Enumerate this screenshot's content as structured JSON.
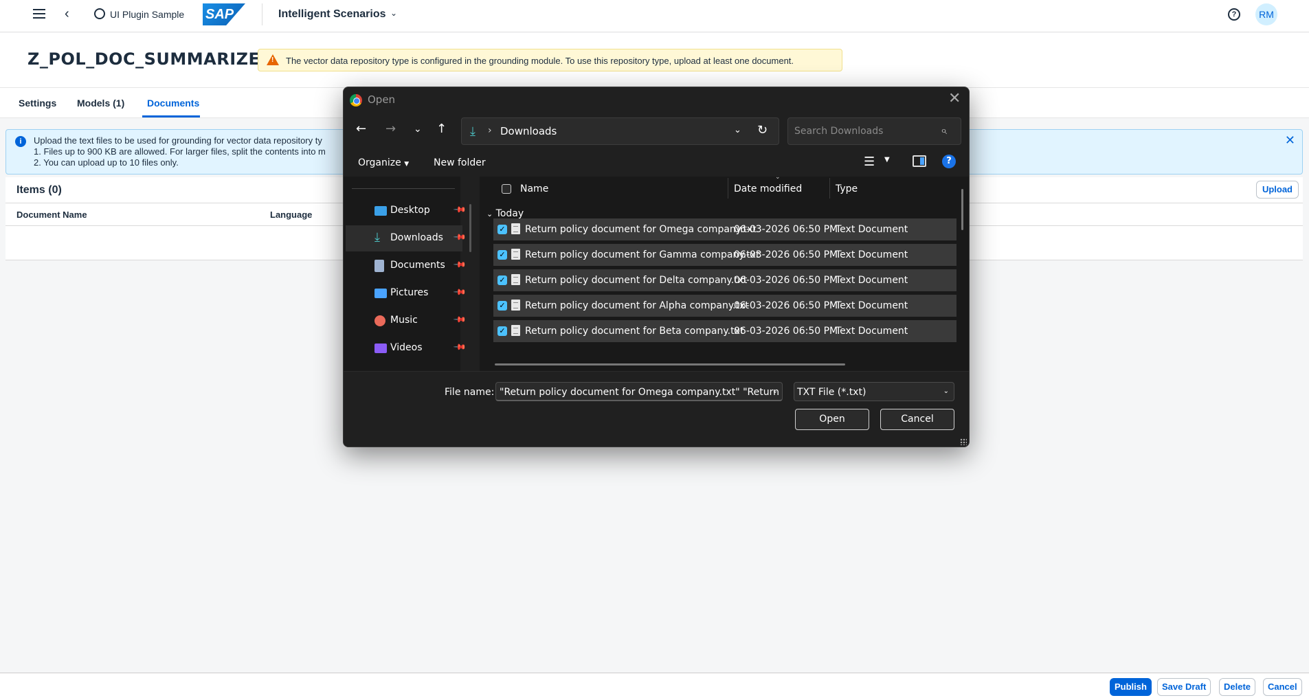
{
  "shell": {
    "app_name": "UI Plugin Sample",
    "sap_logo": "SAP",
    "scenario_menu": "Intelligent Scenarios",
    "help_icon": "?",
    "avatar_initials": "RM"
  },
  "header": {
    "title": "Z_POL_DOC_SUMMARIZE",
    "warning": "The vector data repository type is configured in the grounding module. To use this repository type, upload at least one document."
  },
  "tabs": [
    {
      "label": "Settings",
      "active": false
    },
    {
      "label": "Models (1)",
      "active": false
    },
    {
      "label": "Documents",
      "active": true
    }
  ],
  "info": {
    "line1": "Upload the text files to be used for grounding for vector data repository ty",
    "line2": "1. Files up to 900 KB are allowed. For larger files, split the contents into m",
    "line3": "2. You can upload up to 10 files only."
  },
  "items": {
    "header": "Items (0)",
    "upload_label": "Upload",
    "columns": [
      "Document Name",
      "Language"
    ]
  },
  "footer": {
    "publish": "Publish",
    "save_draft": "Save Draft",
    "delete": "Delete",
    "cancel": "Cancel"
  },
  "dialog": {
    "title": "Open",
    "address_location": "Downloads",
    "search_placeholder": "Search Downloads",
    "organize_label": "Organize",
    "new_folder_label": "New folder",
    "help_label": "?",
    "nav_items": [
      {
        "label": "Desktop",
        "icon": "desktop-icon",
        "color": "#3aa0e8"
      },
      {
        "label": "Downloads",
        "icon": "download-icon",
        "color": "#4cc2c4",
        "selected": true
      },
      {
        "label": "Documents",
        "icon": "document-icon",
        "color": "#9fb3d1"
      },
      {
        "label": "Pictures",
        "icon": "picture-icon",
        "color": "#4aa3ff"
      },
      {
        "label": "Music",
        "icon": "music-icon",
        "color": "#ea6a5a"
      },
      {
        "label": "Videos",
        "icon": "video-icon",
        "color": "#8b5cf6"
      }
    ],
    "columns": {
      "name": "Name",
      "date": "Date modified",
      "type": "Type"
    },
    "group_label": "Today",
    "files": [
      {
        "name": "Return policy document for Omega company.txt",
        "date": "06-03-2026 06:50 PM",
        "type": "Text Document",
        "checked": true
      },
      {
        "name": "Return policy document for Gamma company.txt",
        "date": "06-03-2026 06:50 PM",
        "type": "Text Document",
        "checked": true
      },
      {
        "name": "Return policy document for Delta company.txt",
        "date": "06-03-2026 06:50 PM",
        "type": "Text Document",
        "checked": true
      },
      {
        "name": "Return policy document for Alpha company.txt",
        "date": "06-03-2026 06:50 PM",
        "type": "Text Document",
        "checked": true
      },
      {
        "name": "Return policy document for Beta company.txt",
        "date": "06-03-2026 06:50 PM",
        "type": "Text Document",
        "checked": true
      }
    ],
    "file_name_label": "File name:",
    "file_name_value": "\"Return policy document for Omega company.txt\" \"Return p",
    "file_type_value": "TXT File (*.txt)",
    "open_label": "Open",
    "cancel_label": "Cancel"
  }
}
